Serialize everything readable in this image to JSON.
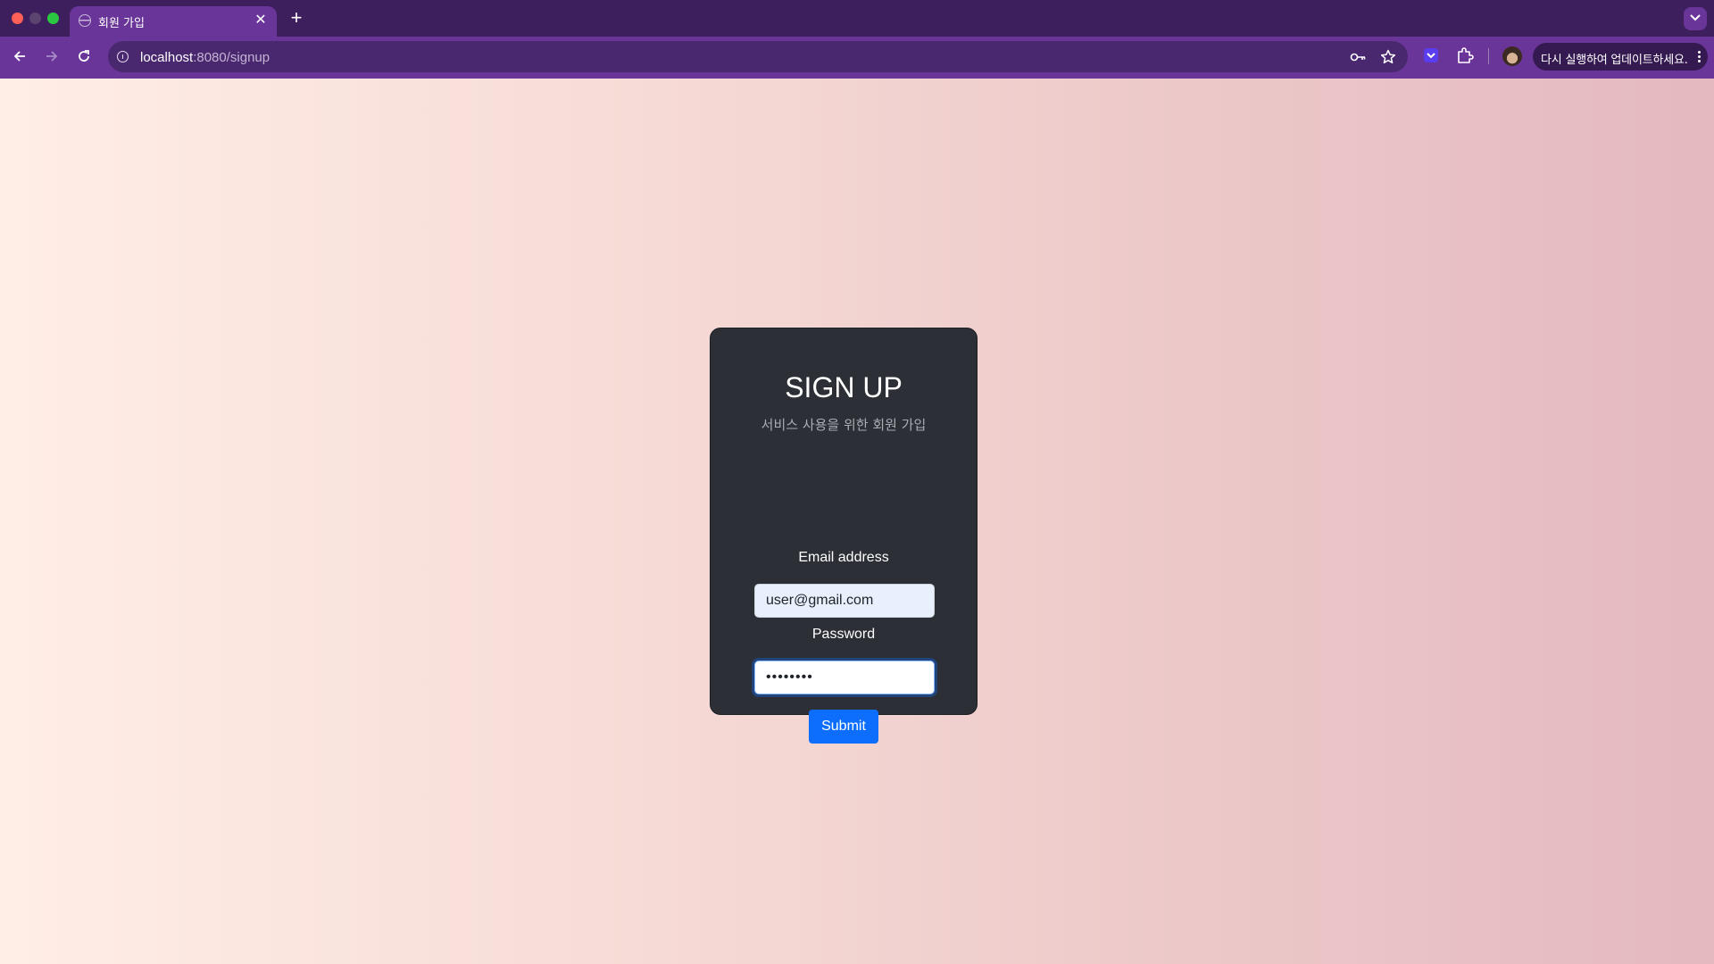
{
  "browser": {
    "tab_title": "회원 가입",
    "url_host": "localhost",
    "url_path": ":8080/signup",
    "update_label": "다시 실행하여 업데이트하세요."
  },
  "colors": {
    "chrome": "#47236b",
    "toolbar": "#6a3598",
    "card": "#2c3036",
    "primary": "#0d6efd"
  },
  "signup": {
    "title": "SIGN UP",
    "subtitle": "서비스 사용을 위한 회원 가입",
    "email_label": "Email address",
    "email_value": "user@gmail.com",
    "password_label": "Password",
    "password_value": "password",
    "submit_label": "Submit"
  }
}
